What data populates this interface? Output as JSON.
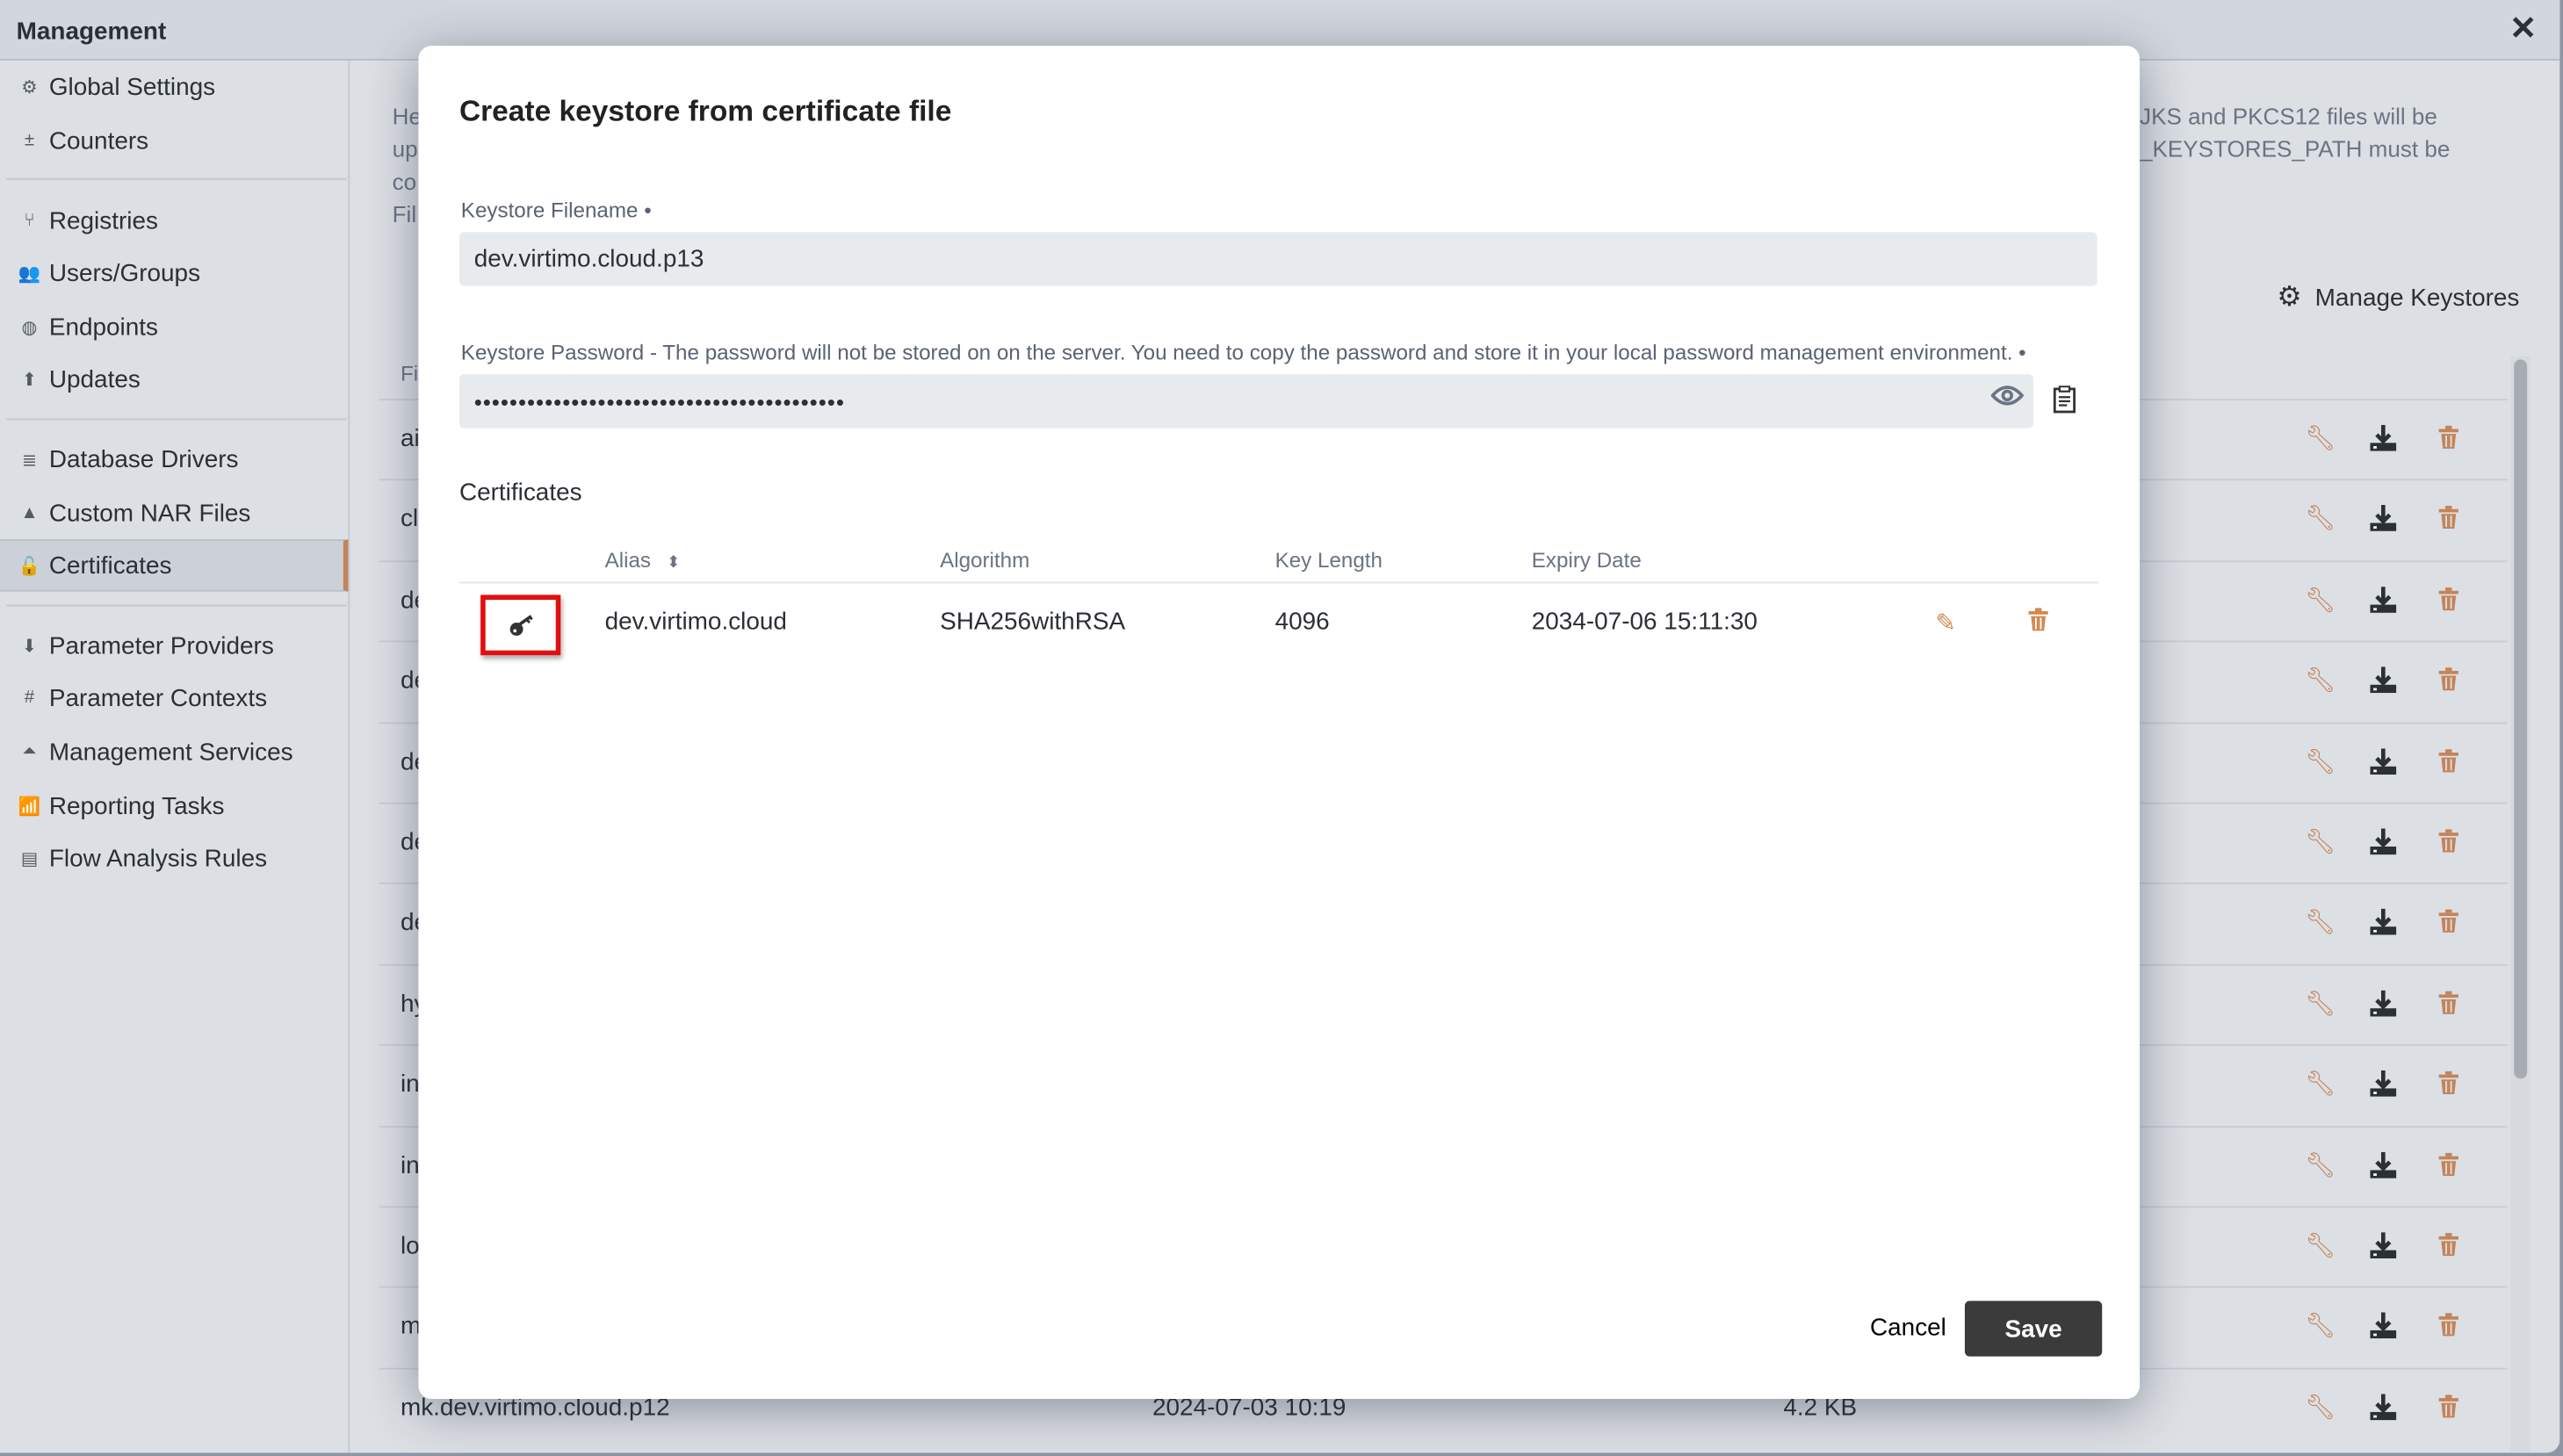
{
  "window": {
    "title": "Management",
    "close_icon": "close-icon"
  },
  "sidebar": {
    "items": [
      {
        "label": "Global Settings",
        "icon": "gears-icon",
        "glyph": "⚙"
      },
      {
        "label": "Counters",
        "icon": "counters-icon",
        "glyph": "±"
      },
      {
        "label": "Registries",
        "icon": "branch-icon",
        "glyph": "⑂"
      },
      {
        "label": "Users/Groups",
        "icon": "users-icon",
        "glyph": "👥"
      },
      {
        "label": "Endpoints",
        "icon": "globe-icon",
        "glyph": "◍"
      },
      {
        "label": "Updates",
        "icon": "upload-circle-icon",
        "glyph": "⬆"
      },
      {
        "label": "Database Drivers",
        "icon": "database-icon",
        "glyph": "≣"
      },
      {
        "label": "Custom NAR Files",
        "icon": "shapes-icon",
        "glyph": "▲"
      },
      {
        "label": "Certificates",
        "icon": "unlock-icon",
        "glyph": "🔓",
        "active": true
      },
      {
        "label": "Parameter Providers",
        "icon": "download-circle-icon",
        "glyph": "⬇"
      },
      {
        "label": "Parameter Contexts",
        "icon": "hash-icon",
        "glyph": "#"
      },
      {
        "label": "Management Services",
        "icon": "bell-icon",
        "glyph": "⏶"
      },
      {
        "label": "Reporting Tasks",
        "icon": "chart-icon",
        "glyph": "📶"
      },
      {
        "label": "Flow Analysis Rules",
        "icon": "clipboard-icon",
        "glyph": "▤"
      }
    ]
  },
  "background": {
    "description_left": [
      "He",
      "up",
      "co",
      "Fil"
    ],
    "description_right": [
      "JKS and PKCS12 files will be",
      "_KEYSTORES_PATH must be"
    ],
    "manage_keystores": "Manage Keystores",
    "column_header_partial": "Fi",
    "rows": [
      {
        "name": "ai"
      },
      {
        "name": "cl"
      },
      {
        "name": "de"
      },
      {
        "name": "de"
      },
      {
        "name": "de"
      },
      {
        "name": "de"
      },
      {
        "name": "de"
      },
      {
        "name": "hy"
      },
      {
        "name": "in"
      },
      {
        "name": "in"
      },
      {
        "name": "lo"
      },
      {
        "name": "m"
      },
      {
        "name": "mk.dev.virtimo.cloud.p12",
        "date": "2024-07-03 10:19",
        "size": "4.2 KB"
      }
    ]
  },
  "dialog": {
    "title": "Create keystore from certificate file",
    "filename_label": "Keystore Filename •",
    "filename_value": "dev.virtimo.cloud.p13",
    "password_label": "Keystore Password - The password will not be stored on on the server. You need to copy the password and store it in your local password management environment. •",
    "password_masked": "••••••••••••••••••••••••••••••••••••••••••",
    "certificates_title": "Certificates",
    "columns": [
      "Alias",
      "Algorithm",
      "Key Length",
      "Expiry Date"
    ],
    "certificates": [
      {
        "alias": "dev.virtimo.cloud",
        "algorithm": "SHA256withRSA",
        "key_length": "4096",
        "expiry": "2034-07-06 15:11:30"
      }
    ],
    "cancel_label": "Cancel",
    "save_label": "Save"
  },
  "colors": {
    "accent": "#c4835a",
    "highlight": "#e01010",
    "save_bg": "#3b3b3b"
  }
}
